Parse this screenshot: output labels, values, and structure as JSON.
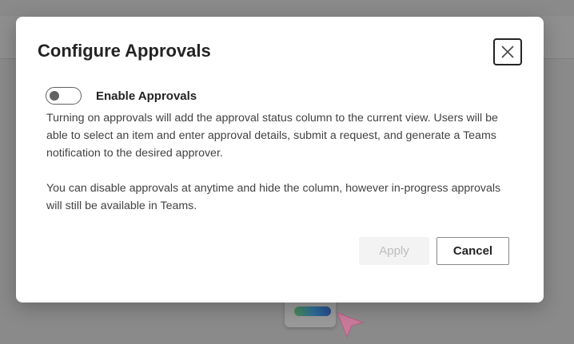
{
  "dialog": {
    "title": "Configure Approvals",
    "close_icon": "close-icon",
    "toggle": {
      "label": "Enable Approvals",
      "state": "off"
    },
    "paragraphs": [
      "Turning on approvals will add the approval status column to the current view. Users will be able to select an item and enter approval details, submit a request, and generate a Teams notification to the desired approver.",
      "You can disable approvals at anytime and hide the column, however in-progress approvals will still be available in Teams."
    ],
    "buttons": {
      "apply_label": "Apply",
      "apply_enabled": false,
      "cancel_label": "Cancel"
    }
  },
  "colors": {
    "overlay": "#8a8a8a",
    "dialog_bg": "#ffffff",
    "text_primary": "#242424",
    "text_body": "#424242",
    "disabled_bg": "#f3f3f3",
    "disabled_text": "#bdbdbd"
  }
}
